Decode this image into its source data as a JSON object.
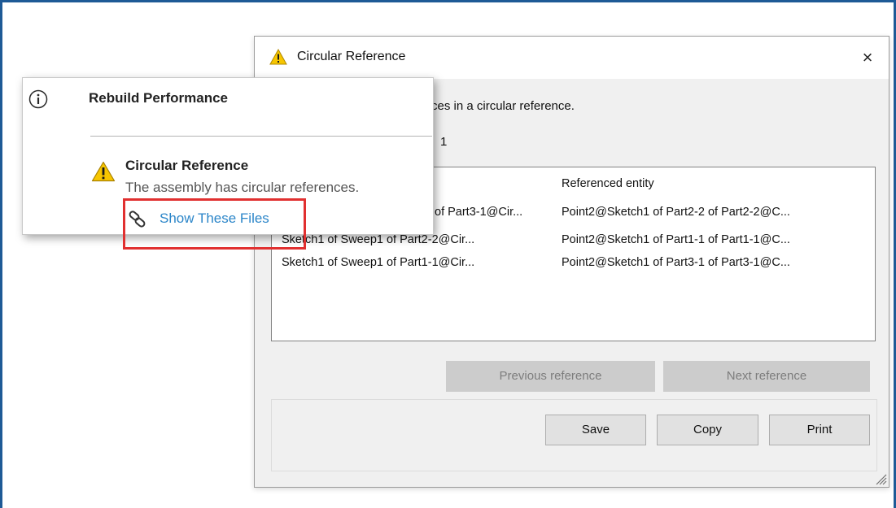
{
  "dialog": {
    "title": "Circular Reference",
    "close_symbol": "×",
    "description_visible": "ces in a circular reference.",
    "count_visible": "1",
    "columns": {
      "entity": "",
      "referenced_entity": "Referenced entity"
    },
    "rows": [
      {
        "entity": "of Part3-1@Cir...",
        "referenced": "Point2@Sketch1 of Part2-2 of Part2-2@C..."
      },
      {
        "entity": "Sketch1  of  Sweep1 of Part2-2@Cir...",
        "referenced": "Point2@Sketch1 of Part1-1 of Part1-1@C..."
      },
      {
        "entity": "Sketch1  of  Sweep1 of Part1-1@Cir...",
        "referenced": "Point2@Sketch1 of Part3-1 of Part3-1@C..."
      }
    ],
    "buttons": {
      "previous": "Previous reference",
      "next": "Next reference",
      "save": "Save",
      "copy": "Copy",
      "print": "Print"
    }
  },
  "popup": {
    "title": "Rebuild Performance",
    "item_title": "Circular Reference",
    "item_text": "The assembly has circular references.",
    "link_text": "Show These Files"
  },
  "colors": {
    "frame_border": "#1e5a96",
    "link": "#2c86c9",
    "highlight": "#e13030",
    "warning": "#f7c600"
  },
  "icons": {
    "title_warning": "warning-icon",
    "popup_info": "info-icon",
    "item_warning": "warning-icon",
    "link": "chain-link-icon"
  }
}
